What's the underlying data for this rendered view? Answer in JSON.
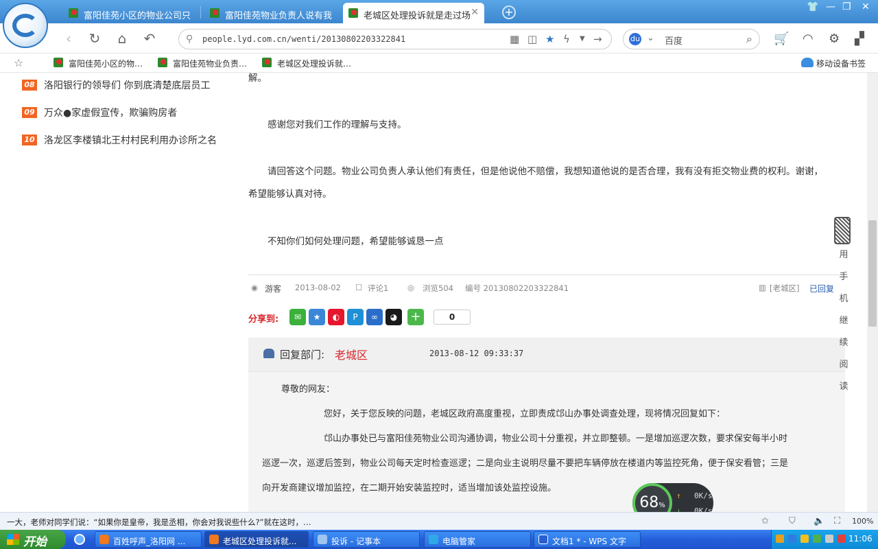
{
  "browser": {
    "tabs": [
      {
        "label": "富阳佳苑小区的物业公司只"
      },
      {
        "label": "富阳佳苑物业负责人说有我"
      },
      {
        "label": "老城区处理投诉就是走过场"
      }
    ],
    "url": "people.lyd.com.cn/wenti/20130802203322841",
    "search_engine": "百度",
    "bookmarks": [
      "富阳佳苑小区的物…",
      "富阳佳苑物业负责…",
      "老城区处理投诉就…"
    ],
    "mobile_bookmarks": "移动设备书签"
  },
  "sidebar": {
    "ranks": [
      {
        "num": "08",
        "text": "洛阳银行的领导们 你到底清楚底层员工"
      },
      {
        "num": "09",
        "text": "万众●家虚假宣传，欺骗购房者"
      },
      {
        "num": "10",
        "text": "洛龙区李楼镇北王村村民利用办诊所之名"
      }
    ]
  },
  "post": {
    "p0": "解。",
    "p1": "感谢您对我们工作的理解与支持。",
    "p2a": "请回答这个问题。物业公司负责人承认他们有责任，但是他说他不赔偿，我想知道他说的是否合理，我有没有拒交物业费的权利。谢谢，",
    "p2b": "希望能够认真对待。",
    "p3": "不知你们如何处理问题，希望能够诚恳一点"
  },
  "meta": {
    "author": "游客",
    "date": "2013-08-02",
    "comments": "评论1",
    "views": "浏览504",
    "id": "编号 20130802203322841",
    "dept": "[老城区]",
    "status": "已回复"
  },
  "share": {
    "label": "分享到:",
    "count": "0"
  },
  "reply": {
    "label": "回复部门:",
    "dept": "老城区",
    "time": "2013-08-12 09:33:37",
    "greeting": "尊敬的网友：",
    "r1": "您好，关于您反映的问题，老城区政府高度重视，立即责成邙山办事处调查处理，现将情况回复如下：",
    "r2a": "邙山办事处已与富阳佳苑物业公司沟通协调，物业公司十分重视，并立即整顿。一是增加巡逻次数，要求保安每半小时",
    "r2b": "巡逻一次，巡逻后签到，物业公司每天定时检查巡逻；二是向业主说明尽量不要把车辆停放在楼道内等监控死角，便于保安看管；三是",
    "r2c": "向开发商建议增加监控，在二期开始安装监控时，适当增加该处监控设施。"
  },
  "side_widget": [
    "用",
    "手",
    "机",
    "继",
    "续",
    "阅",
    "读"
  ],
  "speed": {
    "percent": "68",
    "unit": "%",
    "up": "0K/s",
    "down": "0K/s"
  },
  "statusbar": {
    "ticker": "一大，老师对同学们说：“如果你是皇帝，我是丞相，你会对我说些什么?”就在这时，…",
    "zoom": "100%"
  },
  "taskbar": {
    "start": "开始",
    "tasks": [
      "百姓呼声_洛阳网 ...",
      "老城区处理投诉就...",
      "投诉 - 记事本",
      "电脑管家",
      "文档1 * - WPS 文字"
    ],
    "clock": "11:06"
  }
}
